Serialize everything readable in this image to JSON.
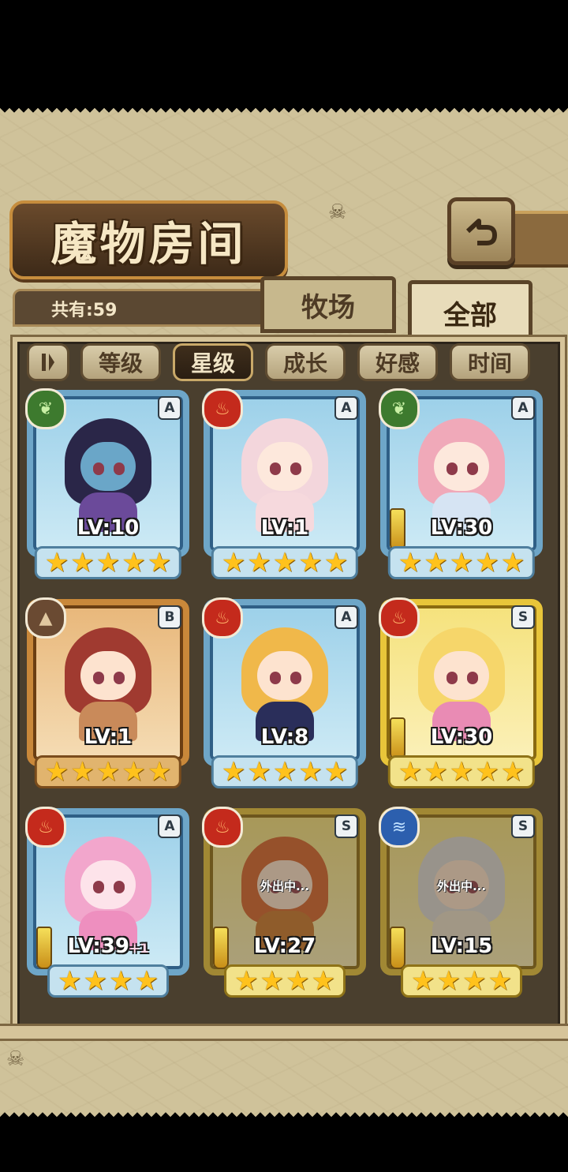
{
  "title": "魔物房间",
  "count_label": "共有:59",
  "tabs": {
    "farm": "牧场",
    "all": "全部"
  },
  "sort": {
    "level": "等级",
    "star": "星级",
    "growth": "成长",
    "affection": "好感",
    "time": "时间"
  },
  "cards": [
    {
      "level": "LV:10",
      "rank": "A",
      "element": "grass",
      "elem_icon": "leaf-icon",
      "frame": "blue",
      "stars": 5,
      "hair": "#2a2648",
      "skin": "#6aa6c8",
      "outfit": "#6b4a9a",
      "weapon": false,
      "away": ""
    },
    {
      "level": "LV:1",
      "rank": "A",
      "element": "fire",
      "elem_icon": "flame-icon",
      "frame": "blue",
      "stars": 5,
      "hair": "#f3d6dc",
      "skin": "#fde8dc",
      "outfit": "#f6d9dd",
      "weapon": false,
      "away": ""
    },
    {
      "level": "LV:30",
      "rank": "A",
      "element": "grass",
      "elem_icon": "leaf-icon",
      "frame": "blue",
      "stars": 5,
      "hair": "#f0a9b9",
      "skin": "#fde8dc",
      "outfit": "#d6e4f3",
      "weapon": true,
      "away": ""
    },
    {
      "level": "LV:1",
      "rank": "B",
      "element": "earth",
      "elem_icon": "mountain-icon",
      "frame": "bronze",
      "stars": 5,
      "hair": "#a03a30",
      "skin": "#fde3cf",
      "outfit": "#c98a5a",
      "weapon": false,
      "away": ""
    },
    {
      "level": "LV:8",
      "rank": "A",
      "element": "fire",
      "elem_icon": "flame-icon",
      "frame": "blue",
      "stars": 5,
      "hair": "#f0b84a",
      "skin": "#fde3cf",
      "outfit": "#2a2e5a",
      "weapon": false,
      "away": ""
    },
    {
      "level": "LV:30",
      "rank": "S",
      "element": "fire",
      "elem_icon": "flame-icon",
      "frame": "gold",
      "stars": 5,
      "hair": "#f6d66a",
      "skin": "#fde3cf",
      "outfit": "#e98bb4",
      "weapon": true,
      "away": ""
    },
    {
      "level": "LV:39",
      "level_plus": "+1",
      "rank": "A",
      "element": "fire",
      "elem_icon": "flame-icon",
      "frame": "blue",
      "stars": 4,
      "hair": "#f2a6cc",
      "skin": "#fde3ea",
      "outfit": "#ee8fbf",
      "weapon": true,
      "away": ""
    },
    {
      "level": "LV:27",
      "rank": "S",
      "element": "fire",
      "elem_icon": "flame-icon",
      "frame": "gold",
      "stars": 4,
      "hair": "#d4602a",
      "skin": "#fde3cf",
      "outfit": "#c8742a",
      "weapon": true,
      "away": "外出中..."
    },
    {
      "level": "LV:15",
      "rank": "S",
      "element": "water",
      "elem_icon": "waves-icon",
      "frame": "gold",
      "stars": 4,
      "hair": "#d8d8d8",
      "skin": "#fde3cf",
      "outfit": "#e8e0cc",
      "weapon": true,
      "away": "外出中..."
    }
  ]
}
